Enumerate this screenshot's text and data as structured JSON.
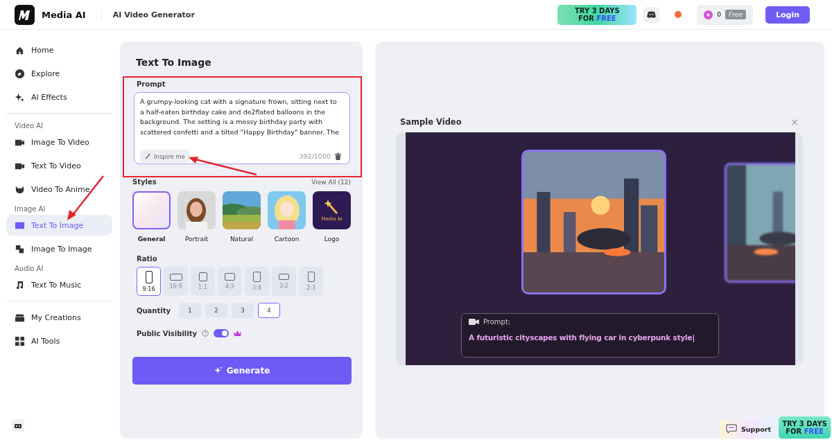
{
  "header": {
    "brand": "Media AI",
    "product": "AI Video Generator",
    "promo": {
      "line1": "TRY 3 DAYS",
      "line2": "FOR",
      "highlight": "FREE"
    },
    "credits": "0",
    "plan": "Free",
    "login": "Login"
  },
  "sidebar": [
    {
      "kind": "item",
      "label": "Home",
      "selected": false
    },
    {
      "kind": "item",
      "label": "Explore",
      "selected": false
    },
    {
      "kind": "item",
      "label": "AI Effects",
      "selected": false
    },
    {
      "kind": "divider"
    },
    {
      "kind": "section",
      "label": "Video AI"
    },
    {
      "kind": "item",
      "label": "Image To Video",
      "selected": false
    },
    {
      "kind": "item",
      "label": "Text To Video",
      "selected": false
    },
    {
      "kind": "item",
      "label": "Video To Anime",
      "selected": false
    },
    {
      "kind": "section",
      "label": "Image AI"
    },
    {
      "kind": "item",
      "label": "Text To Image",
      "selected": true
    },
    {
      "kind": "item",
      "label": "Image To Image",
      "selected": false
    },
    {
      "kind": "section",
      "label": "Audio AI"
    },
    {
      "kind": "item",
      "label": "Text To Music",
      "selected": false
    },
    {
      "kind": "divider"
    },
    {
      "kind": "item",
      "label": "My Creations",
      "selected": false
    },
    {
      "kind": "item",
      "label": "AI Tools",
      "selected": false
    }
  ],
  "form": {
    "title": "Text To Image",
    "prompt_label": "Prompt",
    "prompt": "A grumpy-looking cat with a signature frown, sitting next to a half-eaten birthday cake and de2flated balloons in the background. The setting is a messy birthday party with scattered confetti and a tilted \"Happy Birthday\" banner. The",
    "inspire": "Inspire me",
    "count": "392/1000",
    "styles_label": "Styles",
    "view_all": "View All (12)",
    "styles": [
      {
        "label": "General",
        "kind": "gradient",
        "selected": true
      },
      {
        "label": "Portrait",
        "kind": "picture",
        "selected": false
      },
      {
        "label": "Natural",
        "kind": "picture",
        "selected": false
      },
      {
        "label": "Cartoon",
        "kind": "picture",
        "selected": false
      },
      {
        "label": "Logo",
        "kind": "logo",
        "logo_text": "Media AI",
        "selected": false
      }
    ],
    "ratio_label": "Ratio",
    "ratios": [
      {
        "label": "9:16",
        "selected": true
      },
      {
        "label": "16:9",
        "selected": false
      },
      {
        "label": "1:1",
        "selected": false
      },
      {
        "label": "4:3",
        "selected": false
      },
      {
        "label": "3:4",
        "selected": false
      },
      {
        "label": "3:2",
        "selected": false
      },
      {
        "label": "2:3",
        "selected": false
      }
    ],
    "quantity_label": "Quantity",
    "quantities": [
      {
        "label": "1",
        "selected": false
      },
      {
        "label": "2",
        "selected": false
      },
      {
        "label": "3",
        "selected": false
      },
      {
        "label": "4",
        "selected": true
      }
    ],
    "visibility_label": "Public Visibility",
    "visibility_on": true,
    "generate": "Generate"
  },
  "sample": {
    "title": "Sample Video",
    "close": "×",
    "prompt_label": "Prompt:",
    "prompt_text": "A futuristic cityscapes with flying car in cyberpunk style|"
  },
  "support": "Support",
  "corner_promo": {
    "line1": "TRY 3 DAYS",
    "line2": "FOR",
    "highlight": "FREE"
  }
}
